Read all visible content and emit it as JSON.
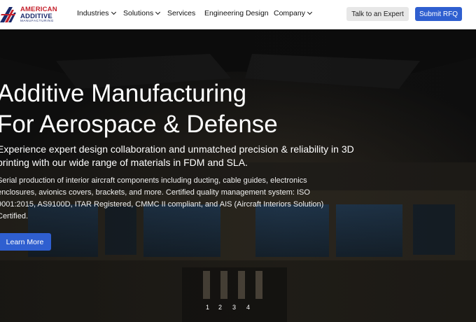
{
  "brand": {
    "line1": "AMERICAN",
    "line2": "ADDITIVE",
    "line3": "MANUFACTURING",
    "colors": {
      "red": "#c4202b",
      "navy": "#1b2a6b"
    }
  },
  "nav": {
    "items": [
      {
        "label": "Industries",
        "has_dropdown": true
      },
      {
        "label": "Solutions",
        "has_dropdown": true
      },
      {
        "label": "Services",
        "has_dropdown": false
      },
      {
        "label": "Engineering Design",
        "has_dropdown": false
      },
      {
        "label": "Company",
        "has_dropdown": true
      }
    ],
    "expert_label": "Talk to an Expert",
    "rfq_label": "Submit RFQ"
  },
  "hero": {
    "title_line1": "Additive Manufacturing",
    "title_line2": "For Aerospace & Defense",
    "subtitle": "Experience expert design collaboration and unmatched precision & reliability in 3D printing with our wide range of materials in FDM and SLA.",
    "body": "Serial production of interior aircraft components including ducting, cable guides, electronics enclosures, avionics covers, brackets, and more. Certified quality management system: ISO 9001:2015, AS9100D, ITAR Registered, CMMC II compliant, and AIS (Aircraft Interiors Solution) Certified.",
    "cta_label": "Learn More"
  },
  "pager": {
    "pages": [
      "1",
      "2",
      "3",
      "4"
    ]
  },
  "colors": {
    "accent": "#2f5fd0",
    "secondary_button": "#e7e7e7"
  }
}
